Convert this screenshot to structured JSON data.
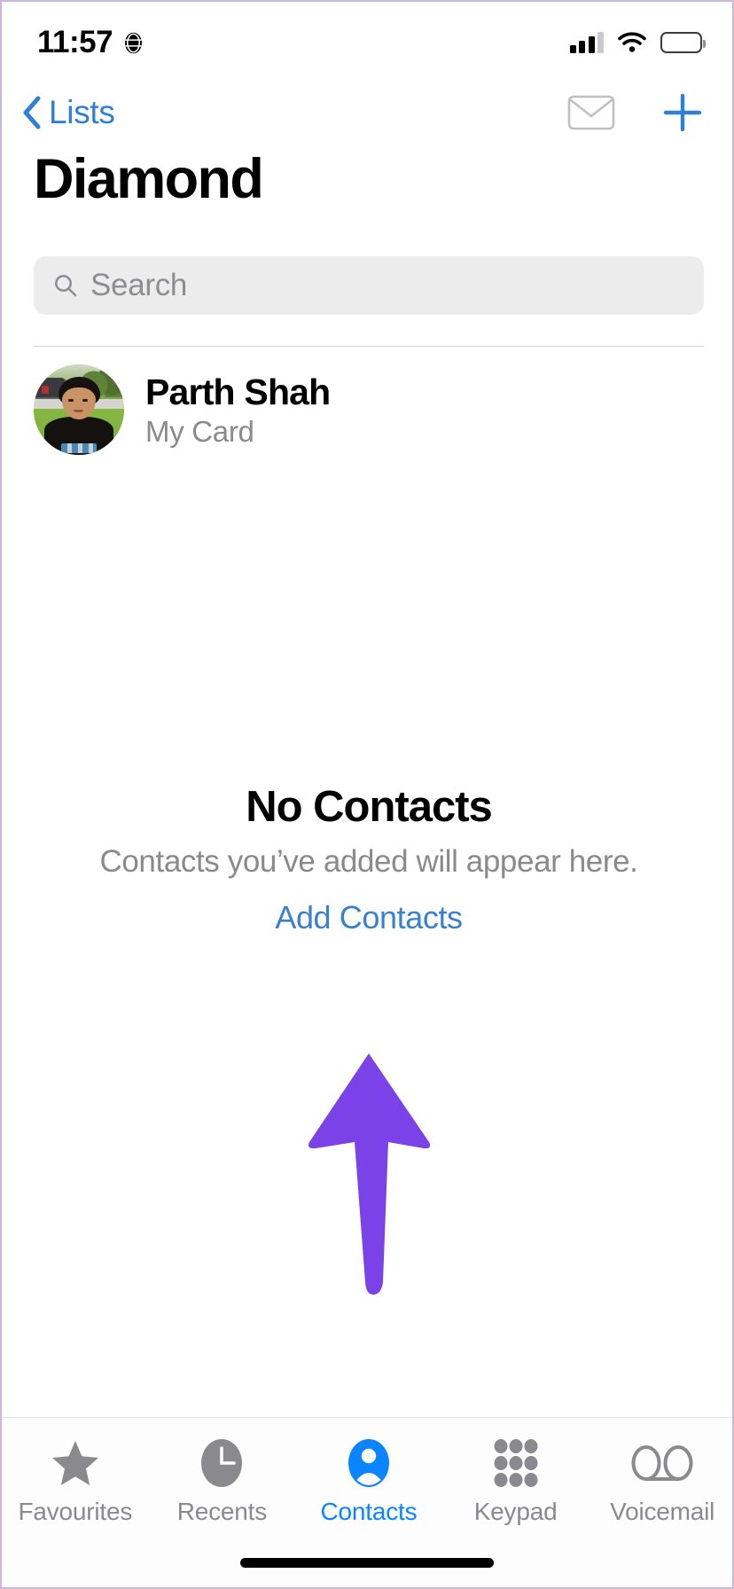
{
  "status_bar": {
    "time": "11:57",
    "location_icon": "globe-icon",
    "signal_icon": "cellular-signal-icon",
    "signal_bars_filled": 3,
    "signal_bars_total": 4,
    "wifi_icon": "wifi-icon",
    "battery_icon": "battery-icon",
    "battery_level_percent": 75
  },
  "nav_bar": {
    "back_label": "Lists",
    "back_icon": "chevron-left-icon",
    "mail_icon": "envelope-icon",
    "add_icon": "plus-icon",
    "accent_color": "#2f7fd4"
  },
  "header": {
    "title": "Diamond"
  },
  "search": {
    "placeholder": "Search",
    "icon": "search-icon",
    "value": ""
  },
  "my_card": {
    "name": "Parth Shah",
    "subtitle": "My Card",
    "avatar": "contact-photo"
  },
  "empty_state": {
    "title": "No Contacts",
    "subtitle": "Contacts you’ve added will appear here.",
    "action_label": "Add Contacts",
    "action_color": "#3b7fd0"
  },
  "annotation": {
    "shape": "up-arrow",
    "color": "#7b42e8",
    "points_to": "Add Contacts"
  },
  "tab_bar": {
    "active_index": 2,
    "active_color": "#0a84ff",
    "inactive_color": "#8a8a8e",
    "items": [
      {
        "label": "Favourites",
        "icon": "star-icon"
      },
      {
        "label": "Recents",
        "icon": "clock-icon"
      },
      {
        "label": "Contacts",
        "icon": "person-circle-icon"
      },
      {
        "label": "Keypad",
        "icon": "keypad-grid-icon"
      },
      {
        "label": "Voicemail",
        "icon": "voicemail-icon"
      }
    ]
  }
}
